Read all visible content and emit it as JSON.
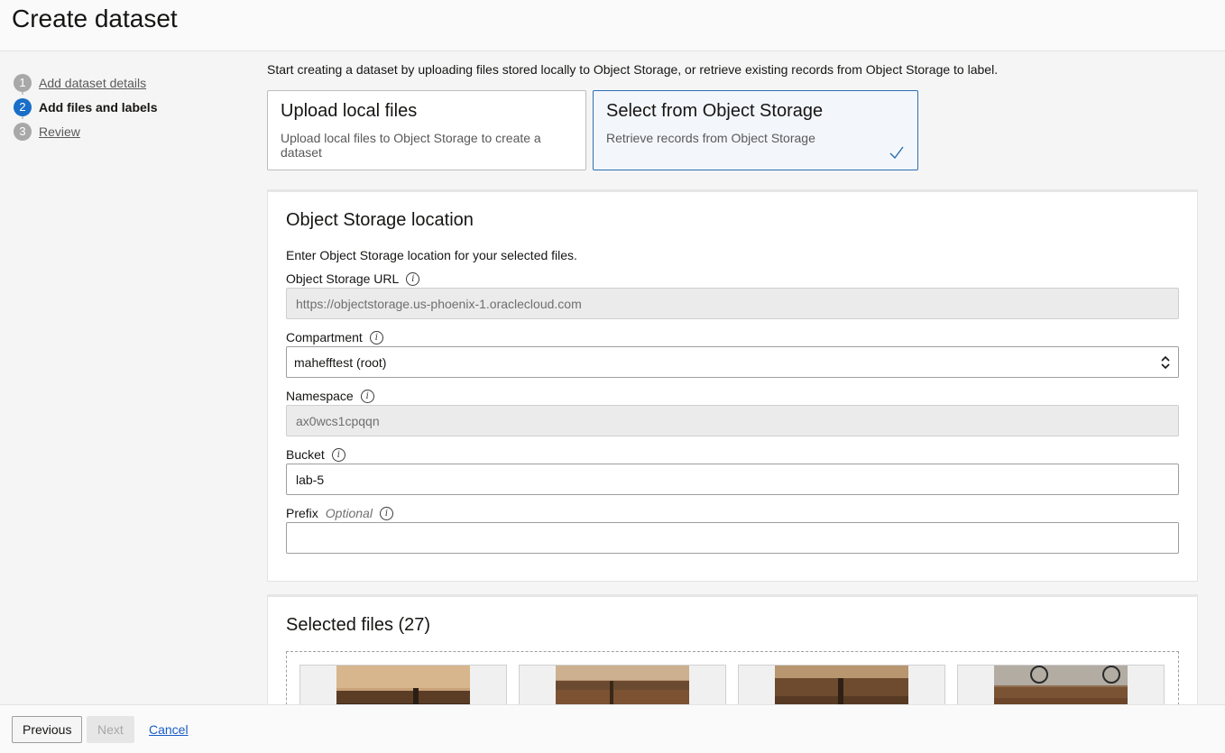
{
  "page": {
    "title": "Create dataset"
  },
  "steps": [
    {
      "num": "1",
      "label": "Add dataset details"
    },
    {
      "num": "2",
      "label": "Add files and labels"
    },
    {
      "num": "3",
      "label": "Review"
    }
  ],
  "intro": "Start creating a dataset by uploading files stored locally to Object Storage, or retrieve existing records from Object Storage to label.",
  "source_options": [
    {
      "title": "Upload local files",
      "desc": "Upload local files to Object Storage to create a dataset"
    },
    {
      "title": "Select from Object Storage",
      "desc": "Retrieve records from Object Storage",
      "selected": true
    }
  ],
  "location": {
    "heading": "Object Storage location",
    "description": "Enter Object Storage location for your selected files.",
    "url_label": "Object Storage URL",
    "url_value": "https://objectstorage.us-phoenix-1.oraclecloud.com",
    "compartment_label": "Compartment",
    "compartment_value": "mahefftest (root)",
    "namespace_label": "Namespace",
    "namespace_value": "ax0wcs1cpqqn",
    "bucket_label": "Bucket",
    "bucket_value": "lab-5",
    "prefix_label": "Prefix",
    "prefix_optional": "Optional",
    "prefix_value": ""
  },
  "files": {
    "heading": "Selected files (27)"
  },
  "footer": {
    "previous": "Previous",
    "next": "Next",
    "cancel": "Cancel"
  },
  "colors": {
    "accent": "#1a6ec7",
    "selected_border": "#2c6fb2"
  }
}
